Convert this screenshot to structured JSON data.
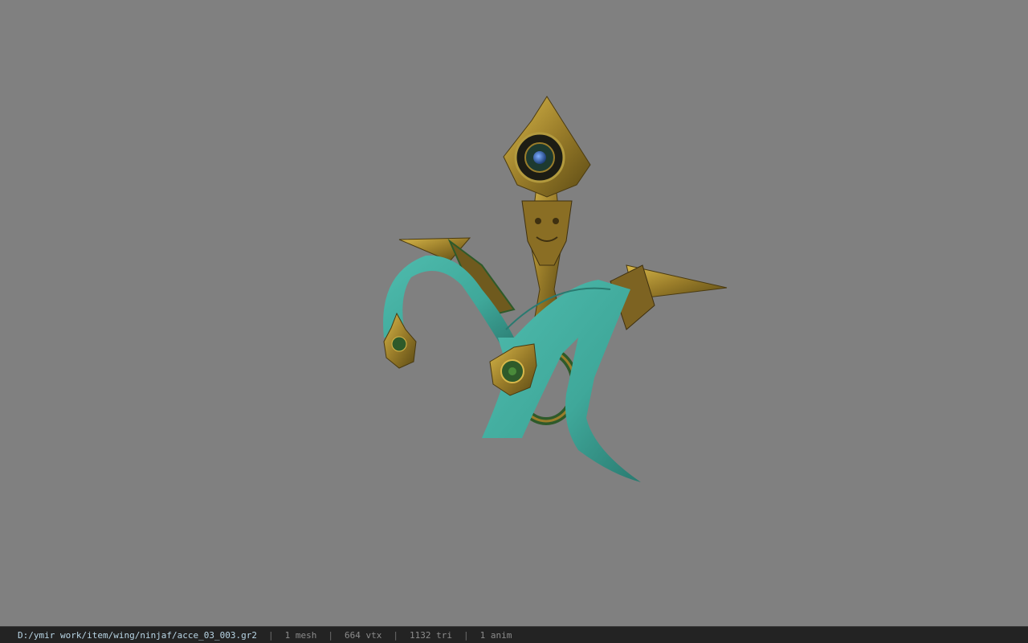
{
  "viewer": {
    "background_color": "#808080",
    "model": {
      "icon": "ornate-accessory-model",
      "colors": {
        "gold": "#9a7d2a",
        "gold_dark": "#5b4a14",
        "gold_light": "#d8b84a",
        "cloth": "#3fa89a",
        "cloth_dark": "#2a7a70",
        "gem": "#2d5fa8",
        "green_inlay": "#2e5a2a"
      }
    }
  },
  "statusbar": {
    "file_path": "D:/ymir work/item/wing/ninjaf/acce_03_003.gr2",
    "separator": "|",
    "mesh": "1 mesh",
    "vertices": "664 vtx",
    "triangles": "1132 tri",
    "animations": "1 anim"
  }
}
